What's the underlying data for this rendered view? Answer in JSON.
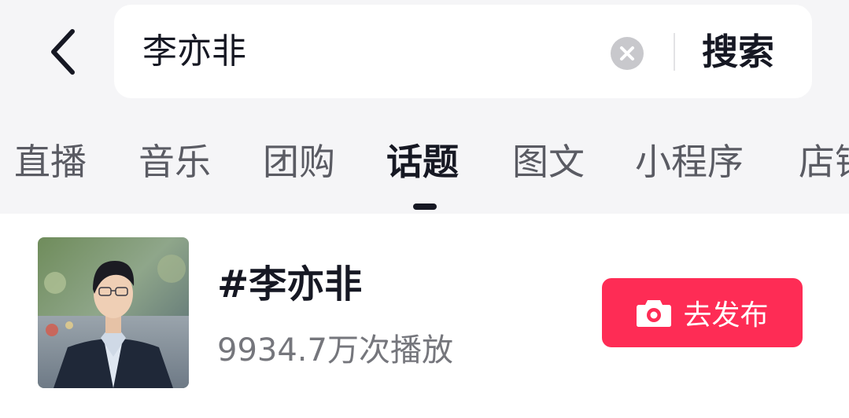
{
  "search": {
    "value": "李亦非",
    "button_label": "搜索"
  },
  "tabs": [
    {
      "label": "直播"
    },
    {
      "label": "音乐"
    },
    {
      "label": "团购"
    },
    {
      "label": "话题",
      "active": true
    },
    {
      "label": "图文"
    },
    {
      "label": "小程序"
    },
    {
      "label": "店铺"
    }
  ],
  "topic": {
    "title": "#李亦非",
    "plays": "9934.7万次播放",
    "publish_label": "去发布"
  },
  "icons": {
    "back": "chevron-left-icon",
    "clear": "clear-circle-icon",
    "camera": "camera-icon"
  },
  "colors": {
    "accent": "#fe2c55",
    "text_primary": "#161823",
    "text_secondary": "#75767c",
    "header_bg": "#f5f5f7"
  }
}
